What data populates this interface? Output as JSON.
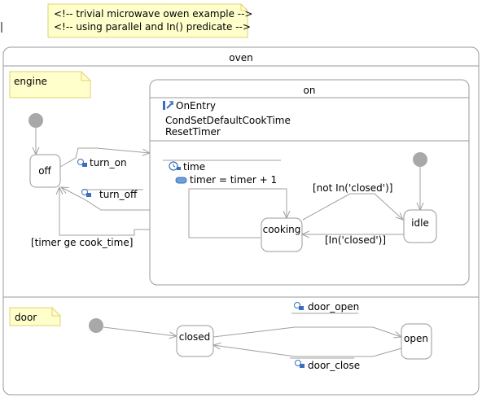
{
  "note": {
    "line1": "<!--  trivial microwave owen example -->",
    "line2": "<!-- using parallel and In() predicate -->"
  },
  "composite": {
    "title": "oven"
  },
  "regions": {
    "engine": {
      "label": "engine"
    },
    "door": {
      "label": "door"
    }
  },
  "states": {
    "off": "off",
    "on": "on",
    "cooking": "cooking",
    "idle": "idle",
    "closed": "closed",
    "open": "open"
  },
  "on_actions": {
    "entry_label": "OnEntry",
    "entry_action_1": "CondSetDefaultCookTime",
    "entry_action_2": "ResetTimer",
    "time_label": "time",
    "time_action": "timer = timer + 1"
  },
  "transitions": {
    "turn_on": "turn_on",
    "turn_off": "turn_off",
    "timer_guard": "[timer ge cook_time]",
    "not_closed": "[not In('closed')]",
    "in_closed": "[In('closed')]",
    "door_open": "door_open",
    "door_close": "door_close"
  },
  "colors": {
    "note_fill": "#ffffcc",
    "note_border": "#e0d070",
    "state_border": "#9a9a9a",
    "initial_dot": "#a8a8a8",
    "arrow": "#a0a0a0",
    "event_icon": "#3a6fc0"
  },
  "icons": {
    "event": "signal-event-icon",
    "entry": "entry-action-icon",
    "time": "clock-icon",
    "action": "action-pill-icon"
  }
}
